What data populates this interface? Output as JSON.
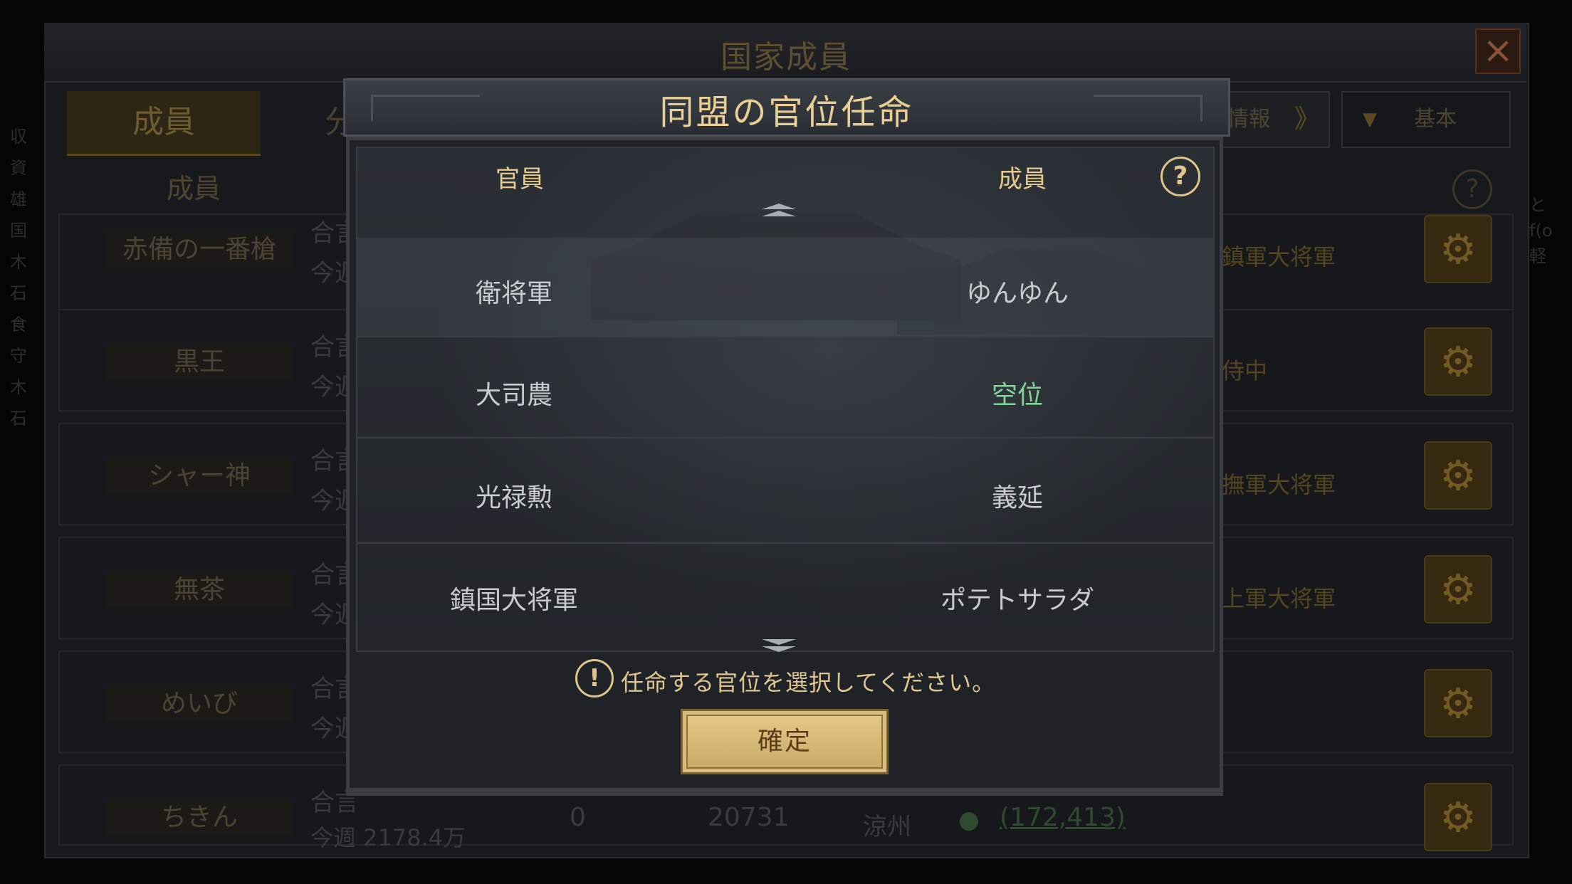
{
  "background": {
    "title": "国家成員",
    "close_icon": "×",
    "tabs": [
      "成員",
      "分"
    ],
    "info_button": {
      "label": "情報",
      "arrow": "》"
    },
    "filter": {
      "arrow": "▼",
      "label": "基本"
    },
    "column_member": "成員",
    "help_symbol": "?",
    "rows": [
      {
        "name": "赤備の一番槍",
        "total_prefix": "合言",
        "week_prefix": "今週",
        "role": "鎮軍大将軍"
      },
      {
        "name": "黒王",
        "total_prefix": "合言",
        "week_prefix": "今週",
        "role": "侍中"
      },
      {
        "name": "シャー神",
        "total_prefix": "合言",
        "week_prefix": "今週",
        "role": "撫軍大将軍"
      },
      {
        "name": "無茶",
        "total_prefix": "合言",
        "week_prefix": "今週",
        "role": "上軍大将軍"
      },
      {
        "name": "めいび",
        "total_prefix": "合言",
        "week_prefix": "今週",
        "role": ""
      },
      {
        "name": "ちきん",
        "total_prefix": "合言",
        "week_prefix": "今週 2178.4万",
        "role": ""
      }
    ],
    "last_row": {
      "val1": "0",
      "val2": "20731",
      "location": "涼州",
      "coords": "(172,413)"
    },
    "gear_icon": "⚙",
    "left_strip": [
      "収",
      "資",
      "雄",
      "国",
      "木",
      "石",
      "食",
      "守",
      "木",
      "石"
    ],
    "right_strip": [
      "と",
      "f(o",
      "軽"
    ]
  },
  "modal": {
    "title": "同盟の官位任命",
    "header_officer": "官員",
    "header_member": "成員",
    "help_symbol": "?",
    "rows": [
      {
        "officer": "衛将軍",
        "member": "ゆんゆん",
        "vacant": false,
        "selected": true
      },
      {
        "officer": "大司農",
        "member": "空位",
        "vacant": true,
        "selected": false
      },
      {
        "officer": "光禄勲",
        "member": "義延",
        "vacant": false,
        "selected": false
      },
      {
        "officer": "鎮国大将軍",
        "member": "ポテトサラダ",
        "vacant": false,
        "selected": false
      }
    ],
    "hint_symbol": "!",
    "hint": "任命する官位を選択してください。",
    "confirm_label": "確定"
  },
  "colors": {
    "accent_gold": "#e6ca8e",
    "vacant_green": "#7fd596",
    "button_gold": "#d9bc7b"
  }
}
